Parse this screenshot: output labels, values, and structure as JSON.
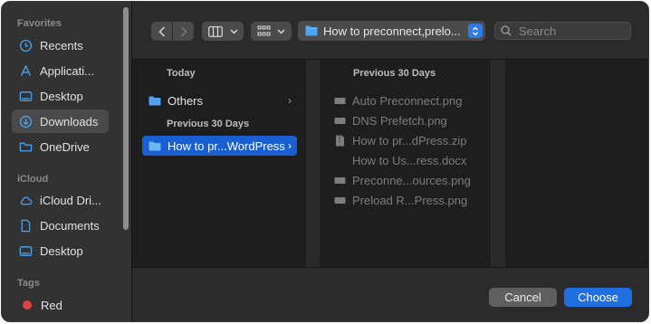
{
  "sidebar": {
    "favorites_heading": "Favorites",
    "favorites": [
      {
        "label": "Recents",
        "icon": "clock-icon"
      },
      {
        "label": "Applicati...",
        "icon": "applications-icon"
      },
      {
        "label": "Desktop",
        "icon": "desktop-icon"
      },
      {
        "label": "Downloads",
        "icon": "downloads-icon",
        "selected": true
      },
      {
        "label": "OneDrive",
        "icon": "folder-icon"
      }
    ],
    "icloud_heading": "iCloud",
    "icloud": [
      {
        "label": "iCloud Dri...",
        "icon": "cloud-icon"
      },
      {
        "label": "Documents",
        "icon": "document-icon"
      },
      {
        "label": "Desktop",
        "icon": "desktop-icon"
      }
    ],
    "tags_heading": "Tags",
    "tags": [
      {
        "label": "Red",
        "color": "#e0433f"
      }
    ]
  },
  "toolbar": {
    "path_label": "How to preconnect,prelo...",
    "search_placeholder": "Search"
  },
  "column1": {
    "today_heading": "Today",
    "today_items": [
      {
        "label": "Others"
      }
    ],
    "prev_heading": "Previous 30 Days",
    "prev_items": [
      {
        "label": "How to pr...WordPress",
        "selected": true
      }
    ]
  },
  "column2": {
    "heading": "Previous 30 Days",
    "files": [
      {
        "label": "Auto Preconnect.png",
        "icon": "image-file-icon"
      },
      {
        "label": "DNS Prefetch.png",
        "icon": "image-file-icon"
      },
      {
        "label": "How to pr...dPress.zip",
        "icon": "zip-file-icon"
      },
      {
        "label": "How to Us...ress.docx",
        "icon": "none"
      },
      {
        "label": "Preconne...ources.png",
        "icon": "image-file-icon"
      },
      {
        "label": "Preload R...Press.png",
        "icon": "image-file-icon"
      }
    ]
  },
  "footer": {
    "cancel_label": "Cancel",
    "choose_label": "Choose"
  },
  "colors": {
    "accent": "#1a5fd1",
    "choose_button": "#1f6fe0",
    "folder": "#4fa3f1"
  }
}
